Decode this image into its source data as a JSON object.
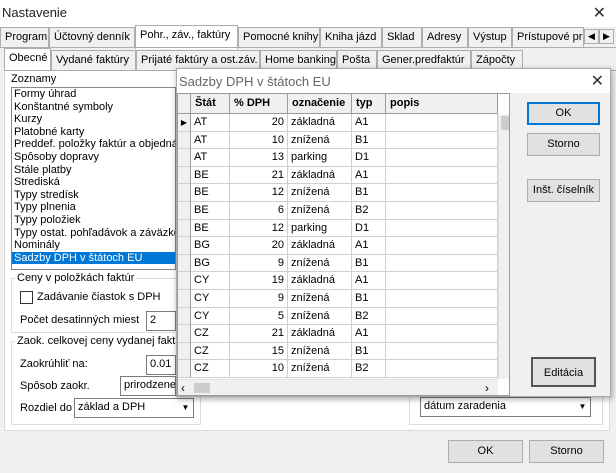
{
  "window": {
    "title": "Nastavenie"
  },
  "main_tabs": [
    {
      "label": "Program"
    },
    {
      "label": "Účtovný denník"
    },
    {
      "label": "Pohr., záv., faktúry"
    },
    {
      "label": "Pomocné knihy"
    },
    {
      "label": "Kniha jázd"
    },
    {
      "label": "Sklad"
    },
    {
      "label": "Adresy"
    },
    {
      "label": "Výstup"
    },
    {
      "label": "Prístupové pr"
    }
  ],
  "sub_tabs": [
    {
      "label": "Obecné"
    },
    {
      "label": "Vydané faktúry"
    },
    {
      "label": "Prijaté faktúry a ost.záv."
    },
    {
      "label": "Home banking"
    },
    {
      "label": "Pošta"
    },
    {
      "label": "Gener.predfaktúr"
    },
    {
      "label": "Zápočty"
    }
  ],
  "lists": {
    "title": "Zoznamy",
    "items": [
      "Formy úhrad",
      "Konštantné symboly",
      "Kurzy",
      "Platobné karty",
      "Preddef. položky faktúr a objedná",
      "Spôsoby dopravy",
      "Stále platby",
      "Strediská",
      "Typy stredísk",
      "Typy plnenia",
      "Typy položiek",
      "Typy ostat. pohľadávok a záväzko",
      "Nominály",
      "Sadzby DPH v štátoch EU"
    ],
    "selected_index": 13
  },
  "prices_group": {
    "title": "Ceny v položkách faktúr",
    "checkbox_label": "Zadávanie čiastok s DPH",
    "decimals_label": "Počet desatinných miest",
    "decimals_value": "2"
  },
  "total_group": {
    "title": "Zaok. celkovej ceny vydanej fakt",
    "round_label": "Zaokrúhliť na:",
    "round_value": "0.01",
    "method_label": "Spôsob zaokr.",
    "method_value": "prirodzene",
    "diff_label": "Rozdiel do",
    "diff_value": "základ a DPH"
  },
  "right_dropdown": {
    "value": "dátum zaradenia"
  },
  "footer": {
    "ok": "OK",
    "cancel": "Storno"
  },
  "dialog": {
    "title": "Sadzby DPH v štátoch EU",
    "columns": [
      "Štát",
      "% DPH",
      "označenie",
      "typ",
      "popis"
    ],
    "rows": [
      {
        "state": "AT",
        "rate": "20",
        "label": "základná",
        "type": "A1"
      },
      {
        "state": "AT",
        "rate": "10",
        "label": "znížená",
        "type": "B1"
      },
      {
        "state": "AT",
        "rate": "13",
        "label": "parking",
        "type": "D1"
      },
      {
        "state": "BE",
        "rate": "21",
        "label": "základná",
        "type": "A1"
      },
      {
        "state": "BE",
        "rate": "12",
        "label": "znížená",
        "type": "B1"
      },
      {
        "state": "BE",
        "rate": "6",
        "label": "znížená",
        "type": "B2"
      },
      {
        "state": "BE",
        "rate": "12",
        "label": "parking",
        "type": "D1"
      },
      {
        "state": "BG",
        "rate": "20",
        "label": "základná",
        "type": "A1"
      },
      {
        "state": "BG",
        "rate": "9",
        "label": "znížená",
        "type": "B1"
      },
      {
        "state": "CY",
        "rate": "19",
        "label": "základná",
        "type": "A1"
      },
      {
        "state": "CY",
        "rate": "9",
        "label": "znížená",
        "type": "B1"
      },
      {
        "state": "CY",
        "rate": "5",
        "label": "znížená",
        "type": "B2"
      },
      {
        "state": "CZ",
        "rate": "21",
        "label": "základná",
        "type": "A1"
      },
      {
        "state": "CZ",
        "rate": "15",
        "label": "znížená",
        "type": "B1"
      },
      {
        "state": "CZ",
        "rate": "10",
        "label": "znížená",
        "type": "B2"
      }
    ],
    "buttons": {
      "ok": "OK",
      "cancel": "Storno",
      "codebook": "Inšt. číselník",
      "edit": "Editácia"
    }
  }
}
